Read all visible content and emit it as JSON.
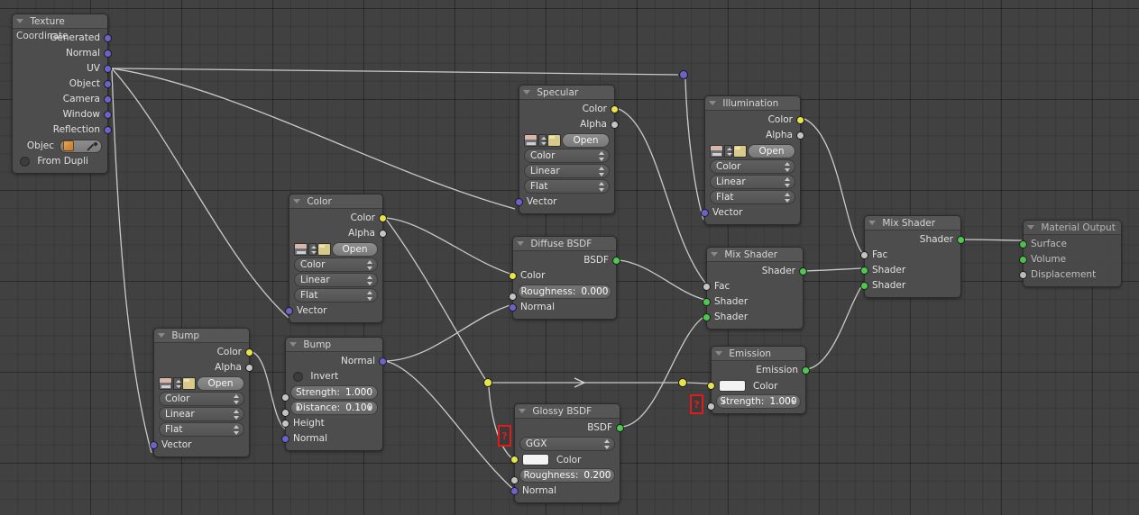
{
  "editor": {
    "name": "blender-node-editor",
    "background_color": "#414141",
    "grid_color": "#383838"
  },
  "nodes": [
    {
      "id": "texture-coordinate",
      "title": "Texture Coordinate",
      "outputs": [
        "Generated",
        "Normal",
        "UV",
        "Object",
        "Camera",
        "Window",
        "Reflection"
      ],
      "object_label": "Objec",
      "from_dupli_label": "From Dupli"
    },
    {
      "id": "color-image-texture",
      "title": "Color",
      "outputs": [
        "Color",
        "Alpha"
      ],
      "open_label": "Open",
      "dropdowns": [
        "Color",
        "Linear",
        "Flat"
      ],
      "inputs": [
        "Vector"
      ]
    },
    {
      "id": "bump-image-texture",
      "title": "Bump",
      "outputs": [
        "Color",
        "Alpha"
      ],
      "open_label": "Open",
      "dropdowns": [
        "Color",
        "Linear",
        "Flat"
      ],
      "inputs": [
        "Vector"
      ]
    },
    {
      "id": "specular-image-texture",
      "title": "Specular",
      "outputs": [
        "Color",
        "Alpha"
      ],
      "open_label": "Open",
      "dropdowns": [
        "Color",
        "Linear",
        "Flat"
      ],
      "inputs": [
        "Vector"
      ]
    },
    {
      "id": "illumination-image-texture",
      "title": "Illumination",
      "outputs": [
        "Color",
        "Alpha"
      ],
      "open_label": "Open",
      "dropdowns": [
        "Color",
        "Linear",
        "Flat"
      ],
      "inputs": [
        "Vector"
      ]
    },
    {
      "id": "bump-node",
      "title": "Bump",
      "outputs": [
        "Normal"
      ],
      "invert_label": "Invert",
      "strength_label": "Strength:",
      "strength_value": "1.000",
      "distance_label": "Distance:",
      "distance_value": "0.100",
      "inputs": [
        "Height",
        "Normal"
      ]
    },
    {
      "id": "diffuse-bsdf",
      "title": "Diffuse BSDF",
      "outputs": [
        "BSDF"
      ],
      "inputs": [
        "Color",
        "Normal"
      ],
      "roughness_label": "Roughness:",
      "roughness_value": "0.000"
    },
    {
      "id": "glossy-bsdf",
      "title": "Glossy BSDF",
      "outputs": [
        "BSDF"
      ],
      "distribution": "GGX",
      "color_label": "Color",
      "roughness_label": "Roughness:",
      "roughness_value": "0.200",
      "inputs": [
        "Normal"
      ]
    },
    {
      "id": "mix-shader-1",
      "title": "Mix Shader",
      "outputs": [
        "Shader"
      ],
      "inputs": [
        "Fac",
        "Shader",
        "Shader"
      ]
    },
    {
      "id": "mix-shader-2",
      "title": "Mix Shader",
      "outputs": [
        "Shader"
      ],
      "inputs": [
        "Fac",
        "Shader",
        "Shader"
      ]
    },
    {
      "id": "emission",
      "title": "Emission",
      "outputs": [
        "Emission"
      ],
      "color_label": "Color",
      "strength_label": "Strength:",
      "strength_value": "1.000"
    },
    {
      "id": "material-output",
      "title": "Material Output",
      "inputs": [
        "Surface",
        "Volume",
        "Displacement"
      ]
    }
  ],
  "markers": [
    {
      "id": "missing-glyph-glossy",
      "text": "?"
    },
    {
      "id": "missing-glyph-emission",
      "text": "?"
    }
  ],
  "socket_colors": {
    "vector": "#6b63c9",
    "color": "#e7e34a",
    "value": "#c4c4c4",
    "shader": "#4ec94e"
  }
}
